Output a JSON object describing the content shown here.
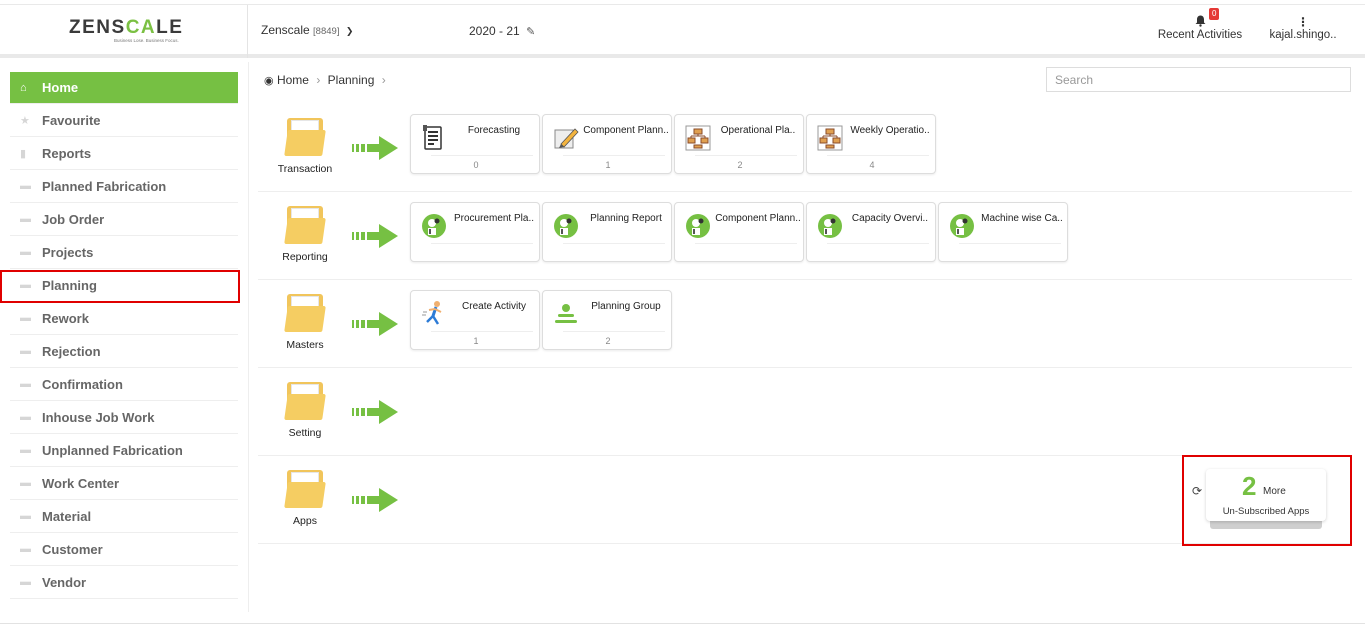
{
  "header": {
    "logo_text": "ZENSCALE",
    "logo_tagline": "Business Lose. Business Focus.",
    "company_name": "Zenscale",
    "company_code": "[8849]",
    "fiscal_year": "2020 - 21",
    "recent_activities_label": "Recent Activities",
    "recent_badge": "0",
    "user_name": "kajal.shingo.."
  },
  "sidebar": {
    "items": [
      {
        "label": "Home",
        "icon": "home-icon"
      },
      {
        "label": "Favourite",
        "icon": "star-icon"
      },
      {
        "label": "Reports",
        "icon": "document-icon"
      },
      {
        "label": "Planned Fabrication",
        "icon": "folder-icon"
      },
      {
        "label": "Job Order",
        "icon": "folder-icon"
      },
      {
        "label": "Projects",
        "icon": "folder-icon"
      },
      {
        "label": "Planning",
        "icon": "folder-icon"
      },
      {
        "label": "Rework",
        "icon": "folder-icon"
      },
      {
        "label": "Rejection",
        "icon": "folder-icon"
      },
      {
        "label": "Confirmation",
        "icon": "folder-icon"
      },
      {
        "label": "Inhouse Job Work",
        "icon": "folder-icon"
      },
      {
        "label": "Unplanned Fabrication",
        "icon": "folder-icon"
      },
      {
        "label": "Work Center",
        "icon": "folder-icon"
      },
      {
        "label": "Material",
        "icon": "folder-icon"
      },
      {
        "label": "Customer",
        "icon": "folder-icon"
      },
      {
        "label": "Vendor",
        "icon": "folder-icon"
      }
    ]
  },
  "breadcrumb": {
    "home": "Home",
    "current": "Planning"
  },
  "search": {
    "placeholder": "Search"
  },
  "sections": [
    {
      "label": "Transaction",
      "tiles": [
        {
          "label": "Forecasting",
          "count": "0",
          "icon": "document-list-icon"
        },
        {
          "label": "Component Plann..",
          "count": "1",
          "icon": "pencil-edit-icon"
        },
        {
          "label": "Operational Pla..",
          "count": "2",
          "icon": "flowchart-icon"
        },
        {
          "label": "Weekly Operatio..",
          "count": "4",
          "icon": "flowchart-icon"
        }
      ]
    },
    {
      "label": "Reporting",
      "tiles": [
        {
          "label": "Procurement Pla..",
          "icon": "report-person-icon"
        },
        {
          "label": "Planning Report",
          "icon": "report-person-icon"
        },
        {
          "label": "Component Plann..",
          "icon": "report-person-icon"
        },
        {
          "label": "Capacity Overvi..",
          "icon": "report-person-icon"
        },
        {
          "label": "Machine wise Ca..",
          "icon": "report-person-icon"
        }
      ]
    },
    {
      "label": "Masters",
      "tiles": [
        {
          "label": "Create Activity",
          "count": "1",
          "icon": "running-person-icon"
        },
        {
          "label": "Planning Group",
          "count": "2",
          "icon": "group-icon"
        }
      ]
    },
    {
      "label": "Setting",
      "tiles": []
    },
    {
      "label": "Apps",
      "tiles": []
    }
  ],
  "more_apps": {
    "count": "2",
    "more_label": "More",
    "sub_label": "Un-Subscribed Apps"
  },
  "colors": {
    "accent": "#76c043",
    "highlight": "#e00000",
    "folder": "#f5cd62"
  }
}
